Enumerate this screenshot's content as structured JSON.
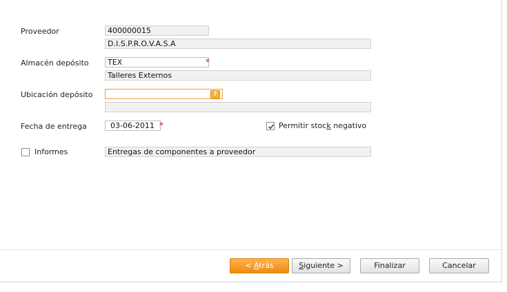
{
  "form": {
    "proveedor": {
      "label": "Proveedor",
      "code": "400000015",
      "name": "D.I.S.P.R.O.V.A.S.A"
    },
    "almacen": {
      "label": "Almacén depósito",
      "code": "TEX",
      "name": "Talleres Externos",
      "required_mark": "*"
    },
    "ubicacion": {
      "label": "Ubicación depósito",
      "value": "",
      "description": "",
      "lookup_icon": "question-lookup-icon",
      "lookup_glyph": "?"
    },
    "fecha": {
      "label": "Fecha de entrega",
      "value": "03-06-2011",
      "required_mark": "*"
    },
    "stock_negativo": {
      "label_before": "Permitir stoc",
      "label_access": "k",
      "label_after": " negativo",
      "checked": true
    },
    "informes": {
      "label": "Informes",
      "checked": false,
      "value": "Entregas de componentes a proveedor"
    }
  },
  "buttons": {
    "back": {
      "prefix": "< ",
      "access": "A",
      "rest": "trás"
    },
    "next": {
      "access": "S",
      "rest": "iguiente >"
    },
    "finish": "Finalizar",
    "cancel": "Cancelar"
  },
  "colors": {
    "accent": "#f08a12",
    "focus_border": "#f0a030",
    "required": "#d42020"
  }
}
